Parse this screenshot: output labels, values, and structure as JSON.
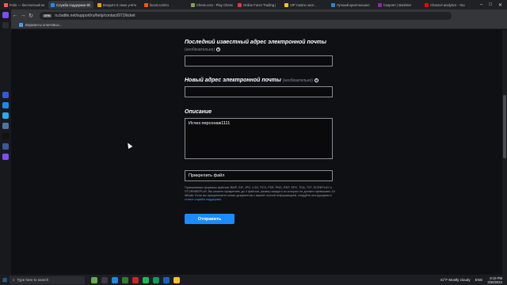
{
  "browser": {
    "tabs": [
      {
        "label": "Folio — бесплатный ко",
        "color": "#ff5a5f"
      },
      {
        "label": "Служба поддержки Bli",
        "color": "#1a8cff",
        "active": true
      },
      {
        "label": "Входите в свою учётн",
        "color": "#ff9900"
      },
      {
        "label": "faceit.com/ru",
        "color": "#ff5500"
      },
      {
        "label": "Chess.com - Play Chess",
        "color": "#7fa650"
      },
      {
        "label": "Online Forex Trading |",
        "color": "#e53935"
      },
      {
        "label": "VIP Casino эксп...",
        "color": "#fbc02d"
      },
      {
        "label": "Лучший криптокошел",
        "color": "#1e88e5"
      },
      {
        "label": "Скарлет | Barrister",
        "color": "#8e24aa"
      },
      {
        "label": "Channel analytics - You",
        "color": "#ff0000"
      }
    ],
    "url": "ru.battle.net/support/ru/help/contact/972/ticket",
    "vpn_badge": "VPN",
    "bookmark": "Варианты ключевых..."
  },
  "form": {
    "last_email_label": "Последний известный адрес электронной почты",
    "last_email_optional": "(необязательно)",
    "last_email_value": "",
    "new_email_label": "Новый адрес электронной почты",
    "new_email_optional": "(необязательно)",
    "new_email_value": "",
    "description_label": "Описание",
    "description_value": "Исчез персонаж1111",
    "attach_label": "Прикрепить файл",
    "note_text": "Приемлемые форматы файлов: BMP, GIF, JPG, LOG, PCX, PDF, PNG, REP, SPX, TGA, TXT, SCREPLAY и STORMREPLAY. Вы можете прикрепить до 4 файлов, размер каждого из которых не должен превышать 16 МБайт. Если вы прикрепляете копии документов с вашей личной информацией, следуйте инструкциям",
    "note_link": "в статье службы поддержки.",
    "submit_label": "Отправить"
  },
  "taskbar": {
    "search_placeholder": "Type here to search",
    "weather": "41°F  Mostly cloudy",
    "lang": "ENG",
    "time": "8:19 PM",
    "date": "3/20/2024"
  }
}
